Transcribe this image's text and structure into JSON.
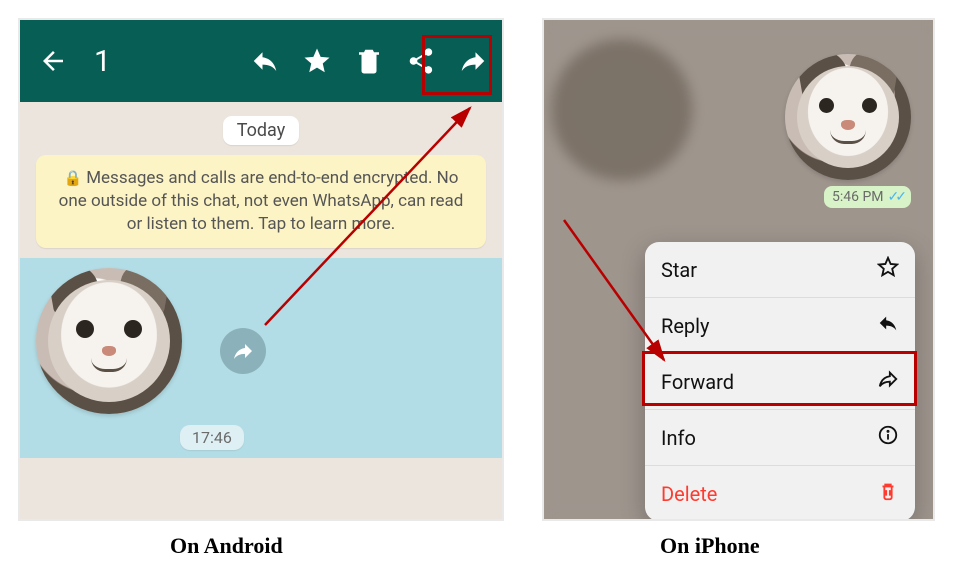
{
  "android": {
    "selected_count": "1",
    "date_label": "Today",
    "encryption_notice": "Messages and calls are end-to-end encrypted. No one outside of this chat, not even WhatsApp, can read or listen to them. Tap to learn more.",
    "message_time": "17:46",
    "toolbar_icons": {
      "back": "back-arrow-icon",
      "reply": "reply-icon",
      "star": "star-icon",
      "delete": "trash-icon",
      "share": "share-icon",
      "forward": "forward-icon"
    }
  },
  "iphone": {
    "sent_time": "5:46 PM",
    "menu": [
      {
        "label": "Star",
        "icon": "star-outline-icon"
      },
      {
        "label": "Reply",
        "icon": "reply-icon"
      },
      {
        "label": "Forward",
        "icon": "forward-icon"
      },
      {
        "label": "Info",
        "icon": "info-icon"
      },
      {
        "label": "Delete",
        "icon": "trash-icon"
      }
    ]
  },
  "captions": {
    "android": "On Android",
    "iphone": "On iPhone"
  },
  "colors": {
    "whatsapp_toolbar": "#075e54",
    "highlight_box": "#b80000",
    "encryption_banner": "#fdf4c5",
    "ios_destructive": "#ff3b30"
  }
}
